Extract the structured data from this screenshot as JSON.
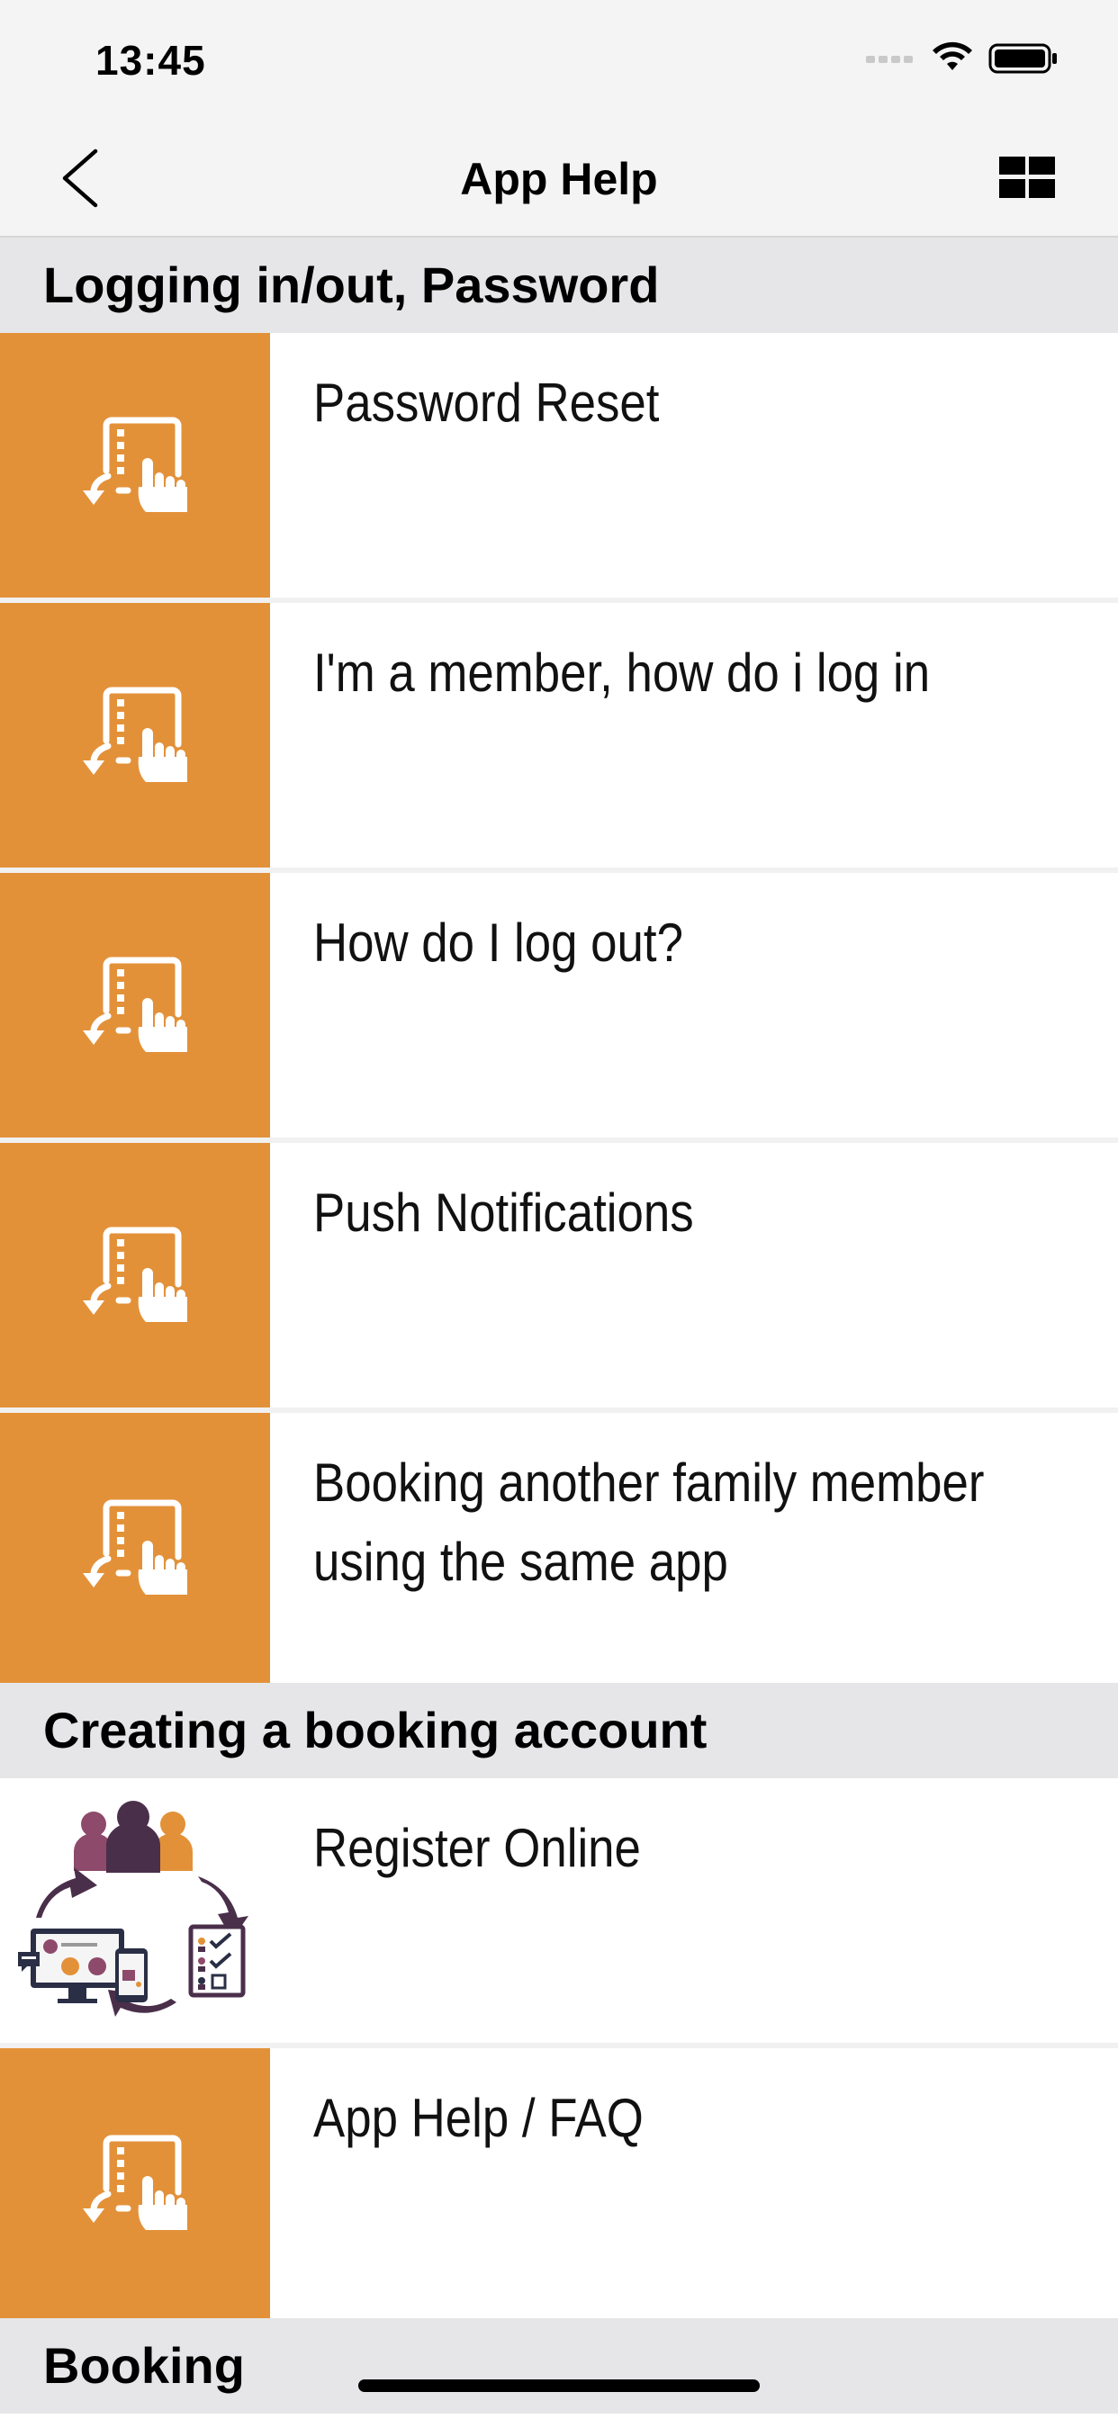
{
  "status_bar": {
    "time": "13:45"
  },
  "nav": {
    "title": "App Help"
  },
  "sections": [
    {
      "title": "Logging in/out, Password",
      "items": [
        {
          "label": "Password Reset",
          "icon": "tablet-touch-icon"
        },
        {
          "label": "I'm a member, how do i log in",
          "icon": "tablet-touch-icon"
        },
        {
          "label": "How do I log out?",
          "icon": "tablet-touch-icon"
        },
        {
          "label": "Push Notifications",
          "icon": "tablet-touch-icon"
        },
        {
          "label": "Booking another family member using the same app",
          "icon": "tablet-touch-icon"
        }
      ]
    },
    {
      "title": "Creating a booking account",
      "items": [
        {
          "label": "Register Online",
          "icon": "register-online-illustration"
        },
        {
          "label": "App Help / FAQ",
          "icon": "tablet-touch-icon"
        }
      ]
    },
    {
      "title": "Booking"
    }
  ],
  "colors": {
    "accent": "#e39139",
    "section_bg": "#e6e6e8",
    "bar_bg": "#f4f4f4"
  }
}
